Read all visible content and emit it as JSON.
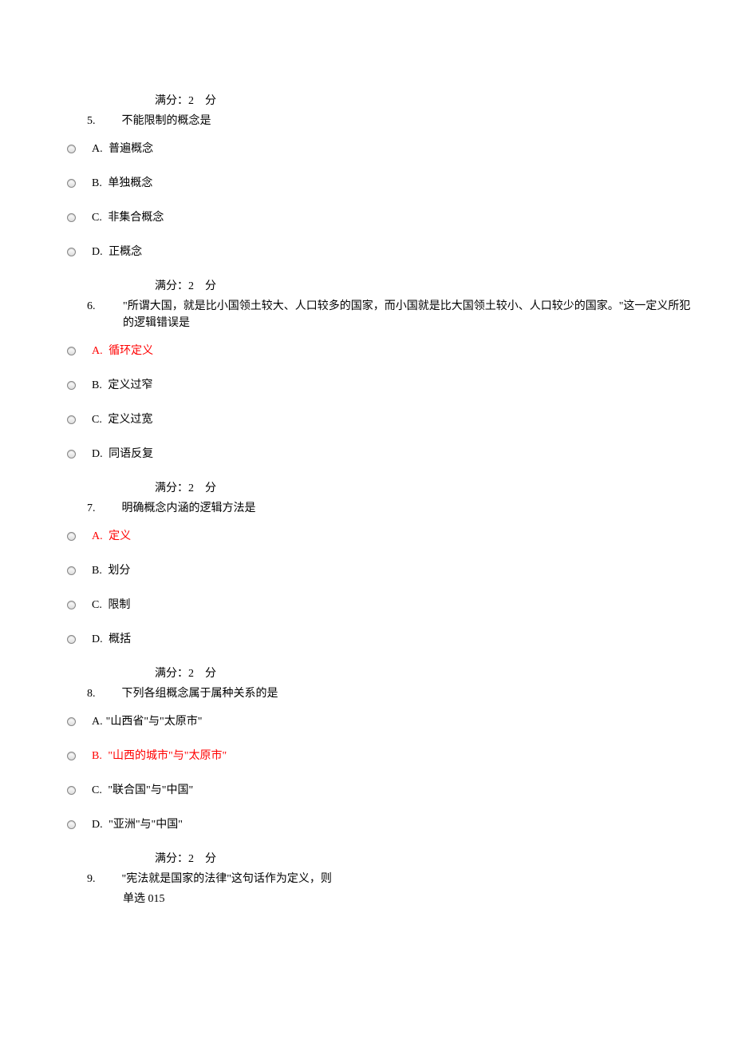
{
  "score_label_prefix": "满分：",
  "score_value": "2",
  "score_label_suffix": "分",
  "questions": [
    {
      "number": "5.",
      "text": "不能限制的概念是",
      "options": [
        {
          "letter": "A.",
          "text": "普遍概念",
          "answer": false
        },
        {
          "letter": "B.",
          "text": "单独概念",
          "answer": false
        },
        {
          "letter": "C.",
          "text": "非集合概念",
          "answer": false
        },
        {
          "letter": "D.",
          "text": "正概念",
          "answer": false
        }
      ]
    },
    {
      "number": "6.",
      "text": "\"所谓大国，就是比小国领土较大、人口较多的国家，而小国就是比大国领土较小、人口较少的国家。\"这一定义所犯的逻辑错误是",
      "options": [
        {
          "letter": "A.",
          "text": "循环定义",
          "answer": true
        },
        {
          "letter": "B.",
          "text": "定义过窄",
          "answer": false
        },
        {
          "letter": "C.",
          "text": "定义过宽",
          "answer": false
        },
        {
          "letter": "D.",
          "text": "同语反复",
          "answer": false
        }
      ]
    },
    {
      "number": "7.",
      "text": "明确概念内涵的逻辑方法是",
      "options": [
        {
          "letter": "A.",
          "text": "定义",
          "answer": true
        },
        {
          "letter": "B.",
          "text": "划分",
          "answer": false
        },
        {
          "letter": "C.",
          "text": "限制",
          "answer": false
        },
        {
          "letter": "D.",
          "text": "概括",
          "answer": false
        }
      ]
    },
    {
      "number": "8.",
      "text": "下列各组概念属于属种关系的是",
      "options": [
        {
          "letter": "A.",
          "text": "\"山西省\"与\"太原市\"",
          "answer": false
        },
        {
          "letter": "B.",
          "text": "\"山西的城市\"与\"太原市\"",
          "answer": true
        },
        {
          "letter": "C.",
          "text": "\"联合国\"与\"中国\"",
          "answer": false
        },
        {
          "letter": "D.",
          "text": "\"亚洲\"与\"中国\"",
          "answer": false
        }
      ]
    }
  ],
  "q9": {
    "number": "9.",
    "text": "\"宪法就是国家的法律\"这句话作为定义，则"
  },
  "footer": "单选 015"
}
